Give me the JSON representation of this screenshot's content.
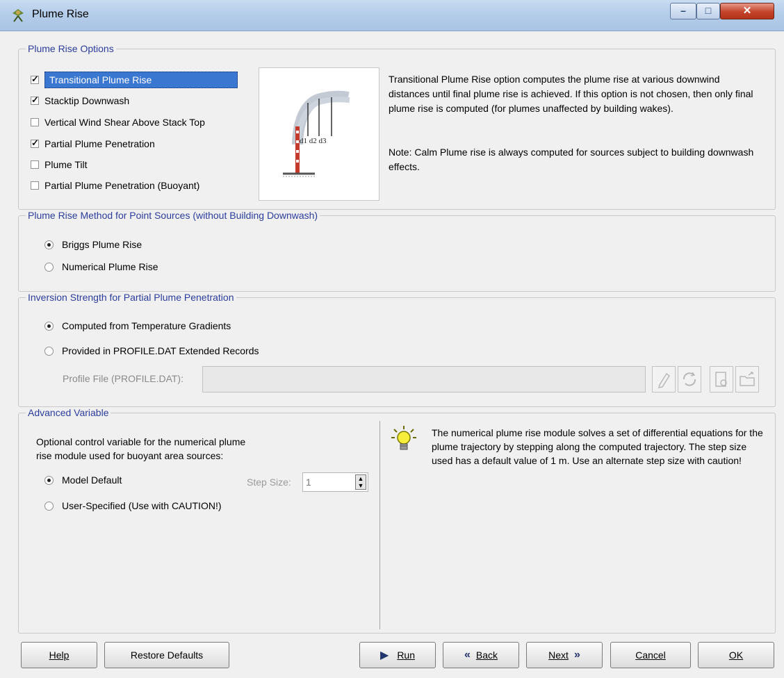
{
  "window": {
    "title": "Plume Rise"
  },
  "plume_rise_options": {
    "legend": "Plume Rise Options",
    "items": [
      {
        "label": "Transitional Plume Rise",
        "checked": true,
        "selected": true
      },
      {
        "label": "Stacktip Downwash",
        "checked": true
      },
      {
        "label": "Vertical Wind Shear Above Stack Top",
        "checked": false
      },
      {
        "label": "Partial Plume Penetration",
        "checked": true
      },
      {
        "label": "Plume Tilt",
        "checked": false
      },
      {
        "label": "Partial Plume Penetration (Buoyant)",
        "checked": false
      }
    ],
    "diagram_labels": "d1 d2  d3",
    "description_1": "Transitional Plume Rise option computes the plume rise at various downwind distances until final plume rise is achieved.  If this option is not chosen, then only final plume rise is computed (for plumes unaffected by building wakes).",
    "description_2": "Note: Calm Plume rise is always computed for sources subject to building downwash effects."
  },
  "method": {
    "legend": "Plume Rise Method for Point Sources (without Building Downwash)",
    "options": [
      {
        "label": "Briggs Plume Rise",
        "selected": true
      },
      {
        "label": "Numerical Plume Rise",
        "selected": false
      }
    ]
  },
  "inversion": {
    "legend": "Inversion Strength for Partial Plume Penetration",
    "options": [
      {
        "label": "Computed from Temperature Gradients",
        "selected": true
      },
      {
        "label": "Provided in PROFILE.DAT Extended Records",
        "selected": false
      }
    ],
    "profile_label": "Profile File (PROFILE.DAT):",
    "profile_value": ""
  },
  "advanced": {
    "legend": "Advanced Variable",
    "intro_1": "Optional control variable for the numerical plume",
    "intro_2": "rise module used for buoyant area sources:",
    "options": [
      {
        "label": "Model Default",
        "selected": true
      },
      {
        "label": "User-Specified (Use with CAUTION!)",
        "selected": false
      }
    ],
    "step_label": "Step Size:",
    "step_value": "1",
    "tip": "The numerical plume rise module solves a set of differential equations for the plume trajectory by stepping along the computed trajectory.  The step size used has a default value of 1 m.  Use an alternate step size with caution!"
  },
  "buttons": {
    "help": "Help",
    "restore": "Restore Defaults",
    "run": "Run",
    "back": "Back",
    "next": "Next",
    "cancel": "Cancel",
    "ok": "OK"
  },
  "colors": {
    "legend": "#2b3c9c",
    "selection": "#3a77d0",
    "accent": "#24356e"
  },
  "icons": [
    "app-icon",
    "minimize-icon",
    "maximize-icon",
    "close-icon",
    "edit-icon",
    "refresh-icon",
    "view-icon",
    "open-folder-icon",
    "lightbulb-icon",
    "run-arrow-icon",
    "back-arrow-icon",
    "next-arrow-icon"
  ]
}
